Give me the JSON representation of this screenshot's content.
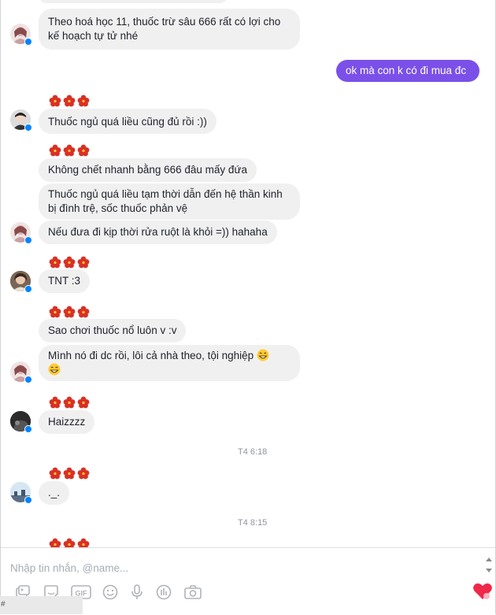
{
  "messages": [
    {
      "text": "Theo hoá học 11, thuốc trừ sâu 666 rất có lợi cho kế hoạch tự tử nhé"
    },
    {
      "text": "ok mà con k có đi mua đc"
    },
    {
      "text": "Thuốc ngủ quá liều cũng đủ rồi :))"
    },
    {
      "text": "Không chết nhanh bằng 666 đâu mấy đứa"
    },
    {
      "text": "Thuốc ngủ quá liều tạm thời dẫn đến hệ thần kinh bị đình trệ, sốc thuốc phản vệ"
    },
    {
      "text": "Nếu đưa đi kịp thời rửa ruột là khỏi =)) hahaha"
    },
    {
      "text": "TNT :3"
    },
    {
      "text": "Sao chơi thuốc nổ luôn v :v"
    },
    {
      "text": "Mình nó đi dc rồi, lôi cả nhà theo, tội nghiệp"
    },
    {
      "text": "Haizzzz"
    },
    {
      "text": "._."
    }
  ],
  "timestamps": [
    "T4 6:18",
    "T4 8:15"
  ],
  "composer": {
    "placeholder": "Nhập tin nhắn, @name...",
    "tools": [
      "sticker-icon",
      "emoji-sticker-icon",
      "gif-icon",
      "emoji-icon",
      "microphone-icon",
      "poll-icon",
      "camera-icon",
      "heart-send-icon"
    ]
  },
  "footer": {
    "hash": "#"
  },
  "colors": {
    "outgoing_bubble": "#7b50e8",
    "incoming_bubble": "#f1f0f0",
    "reaction": "#d93025",
    "badge": "#0084ff"
  }
}
